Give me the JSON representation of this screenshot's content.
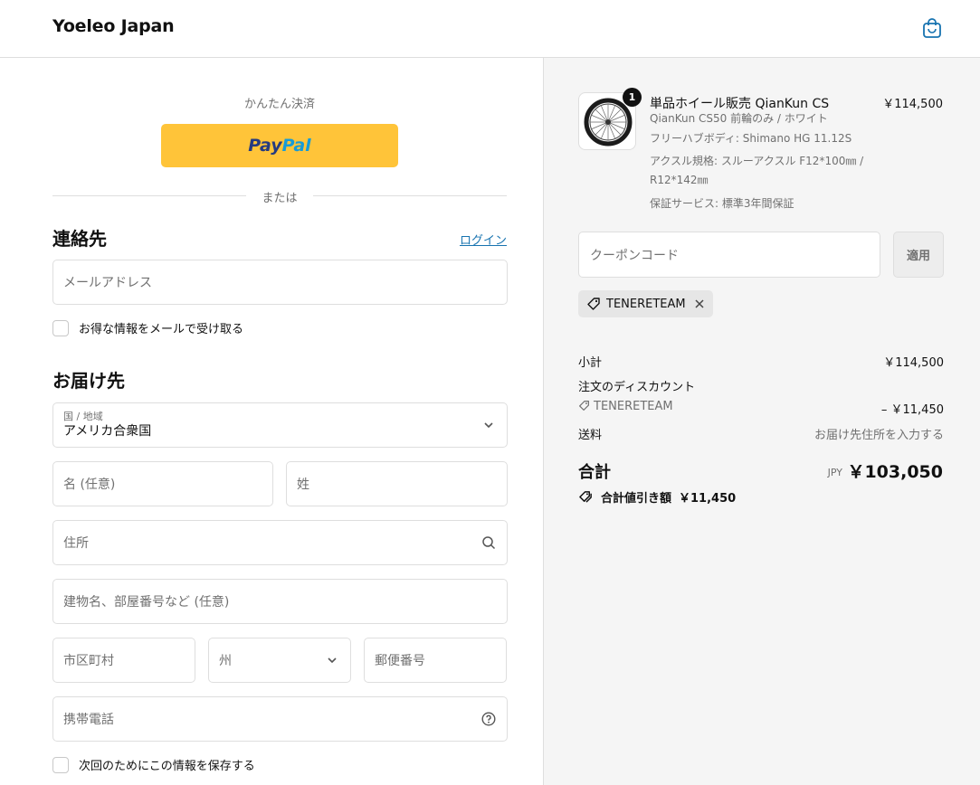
{
  "header": {
    "brand": "Yoeleo Japan",
    "cart_icon": "shopping-bag-icon"
  },
  "express": {
    "label": "かんたん決済",
    "paypal_part1": "Pay",
    "paypal_part2": "Pal",
    "divider": "または"
  },
  "contact": {
    "title": "連絡先",
    "login": "ログイン",
    "email_placeholder": "メールアドレス",
    "newsletter_label": "お得な情報をメールで受け取る"
  },
  "delivery": {
    "title": "お届け先",
    "country_label": "国 / 地域",
    "country_value": "アメリカ合衆国",
    "first_name_placeholder": "名 (任意)",
    "last_name_placeholder": "姓",
    "address_placeholder": "住所",
    "apartment_placeholder": "建物名、部屋番号など (任意)",
    "city_placeholder": "市区町村",
    "state_placeholder": "州",
    "zip_placeholder": "郵便番号",
    "phone_placeholder": "携帯電話",
    "save_info_label": "次回のためにこの情報を保存する"
  },
  "order": {
    "item": {
      "quantity": "1",
      "name": "単品ホイール販売 QianKun CS",
      "price": "￥114,500",
      "variant": "QianKun CS50 前輪のみ / ホワイト",
      "hub": "フリーハブボディ: Shimano HG 11.12S",
      "axle_line1": "アクスル規格: スルーアクスル F12*100㎜ /",
      "axle_line2": "R12*142㎜",
      "warranty": "保証サービス: 標準3年間保証"
    },
    "coupon_placeholder": "クーポンコード",
    "apply_label": "適用",
    "applied_code": "TENERETEAM",
    "subtotal_label": "小計",
    "subtotal_value": "￥114,500",
    "discount_label": "注文のディスカウント",
    "discount_code": "TENERETEAM",
    "discount_value": "– ￥11,450",
    "shipping_label": "送料",
    "shipping_value": "お届け先住所を入力する",
    "total_label": "合計",
    "total_currency": "JPY",
    "total_value": "￥103,050",
    "savings_label": "合計値引き額",
    "savings_value": "￥11,450"
  },
  "colors": {
    "paypal": "#ffc439",
    "link": "#1773b0",
    "panel": "#f5f5f5"
  }
}
